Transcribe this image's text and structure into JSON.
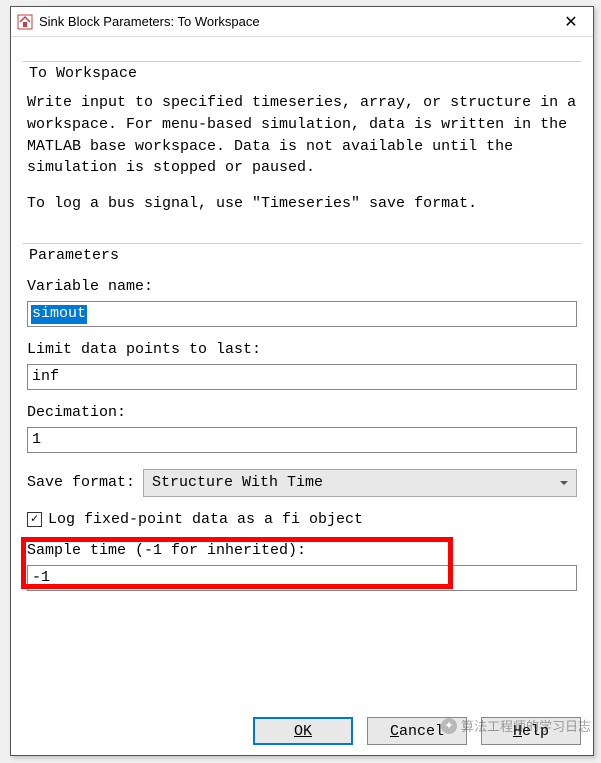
{
  "titlebar": {
    "title": "Sink Block Parameters: To Workspace"
  },
  "section_title": "To Workspace",
  "description": {
    "p1": "Write input to specified timeseries, array, or structure in a workspace. For menu-based simulation, data is written in the MATLAB base workspace. Data is not available until the simulation is stopped or paused.",
    "p2": "To log a bus signal, use \"Timeseries\" save format."
  },
  "parameters_title": "Parameters",
  "fields": {
    "variable_name": {
      "label": "Variable name:",
      "value": "simout"
    },
    "limit_points": {
      "label": "Limit data points to last:",
      "value": "inf"
    },
    "decimation": {
      "label": "Decimation:",
      "value": "1"
    },
    "save_format": {
      "label": "Save format:",
      "value": "Structure With Time"
    },
    "log_fixed": {
      "label": "Log fixed-point data as a fi object",
      "checked": true
    },
    "sample_time": {
      "label": "Sample time (-1 for inherited):",
      "value": "-1"
    }
  },
  "buttons": {
    "ok": "OK",
    "cancel": "Cancel",
    "help": "Help"
  },
  "watermark": "算法工程师的学习日志"
}
